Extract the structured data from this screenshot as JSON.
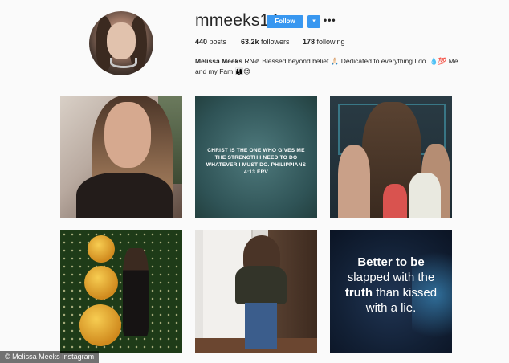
{
  "profile": {
    "username": "mmeeks14",
    "follow_label": "Follow",
    "dropdown_glyph": "▾",
    "more_glyph": "•••",
    "stats": {
      "posts_count": "440",
      "posts_label": "posts",
      "followers_count": "63.2k",
      "followers_label": "followers",
      "following_count": "178",
      "following_label": "following"
    },
    "bio_name": "Melissa Meeks",
    "bio_line1": "RN✐  Blessed beyond belief 🙏🏻 Dedicated to everything I do. 💧💯 Me",
    "bio_line2": "and my Fam 👨‍👩‍👦😍"
  },
  "posts": {
    "verse_text": "CHRIST IS THE ONE WHO GIVES ME THE STRENGTH I NEED TO DO WHATEVER I MUST DO. PHILIPPIANS 4:13 ERV",
    "quote_part1": "Better to be",
    "quote_part2": "slapped with the",
    "quote_bold": "truth",
    "quote_part3": "than kissed",
    "quote_part4": "with a lie."
  },
  "credit": "© Melissa Meeks Instagram",
  "colors": {
    "accent": "#3897f0",
    "background": "#fafafa",
    "text": "#262626"
  }
}
